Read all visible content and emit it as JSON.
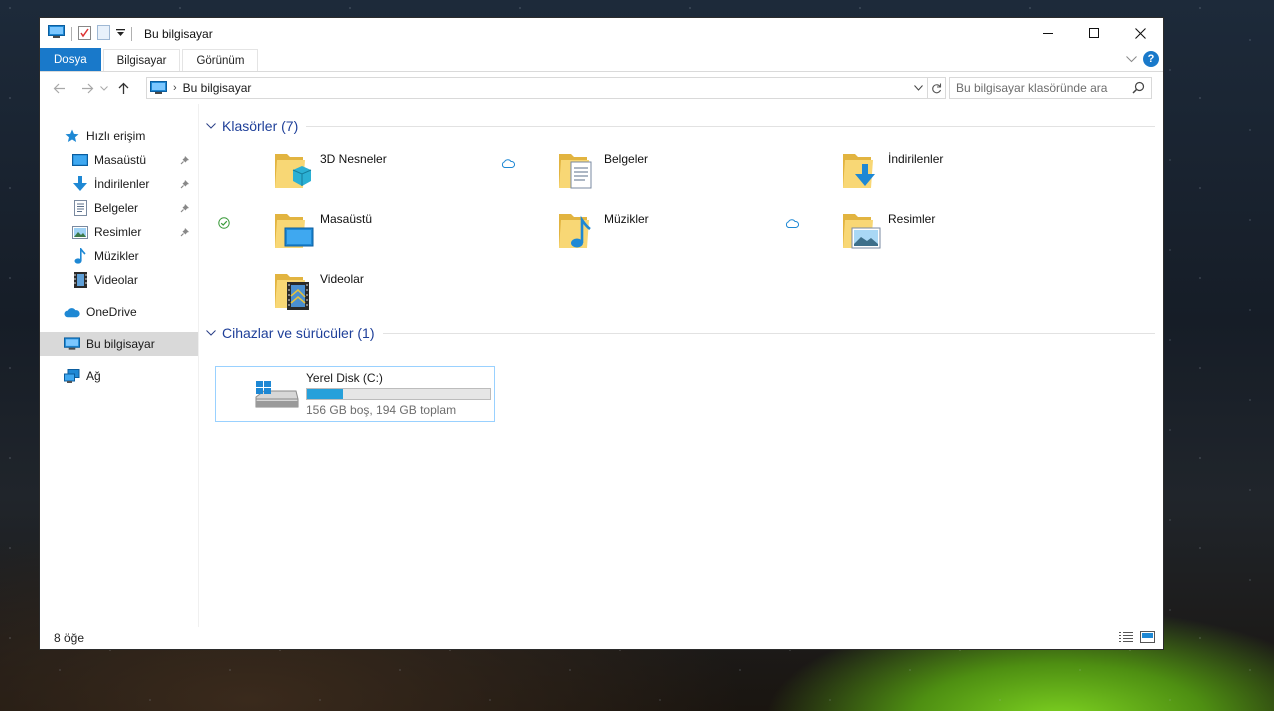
{
  "window": {
    "title": "Bu bilgisayar",
    "accent": "#1979ca"
  },
  "ribbon": {
    "tabs": [
      {
        "label": "Dosya"
      },
      {
        "label": "Bilgisayar"
      },
      {
        "label": "Görünüm"
      }
    ]
  },
  "nav": {
    "breadcrumb": "Bu bilgisayar",
    "search_placeholder": "Bu bilgisayar klasöründe ara"
  },
  "sidebar": {
    "quick_access": "Hızlı erişim",
    "items": [
      {
        "label": "Masaüstü",
        "icon": "desktop-icon",
        "pinned": true
      },
      {
        "label": "İndirilenler",
        "icon": "download-icon",
        "pinned": true
      },
      {
        "label": "Belgeler",
        "icon": "document-icon",
        "pinned": true
      },
      {
        "label": "Resimler",
        "icon": "picture-icon",
        "pinned": true
      },
      {
        "label": "Müzikler",
        "icon": "music-icon",
        "pinned": false
      },
      {
        "label": "Videolar",
        "icon": "video-icon",
        "pinned": false
      }
    ],
    "onedrive": "OneDrive",
    "this_pc": "Bu bilgisayar",
    "network": "Ağ"
  },
  "folders": {
    "header": "Klasörler (7)",
    "items": [
      {
        "label": "3D Nesneler",
        "icon": "3d-objects-icon",
        "status": ""
      },
      {
        "label": "Belgeler",
        "icon": "documents-folder-icon",
        "status": "cloud"
      },
      {
        "label": "İndirilenler",
        "icon": "downloads-folder-icon",
        "status": ""
      },
      {
        "label": "Masaüstü",
        "icon": "desktop-folder-icon",
        "status": "synced"
      },
      {
        "label": "Müzikler",
        "icon": "music-folder-icon",
        "status": ""
      },
      {
        "label": "Resimler",
        "icon": "pictures-folder-icon",
        "status": "cloud"
      },
      {
        "label": "Videolar",
        "icon": "videos-folder-icon",
        "status": ""
      }
    ]
  },
  "devices": {
    "header": "Cihazlar ve sürücüler (1)",
    "drives": [
      {
        "name": "Yerel Disk (C:)",
        "info": "156 GB boş, 194 GB toplam",
        "used_fraction": 0.196
      }
    ]
  },
  "status": {
    "item_count": "8 öğe"
  }
}
